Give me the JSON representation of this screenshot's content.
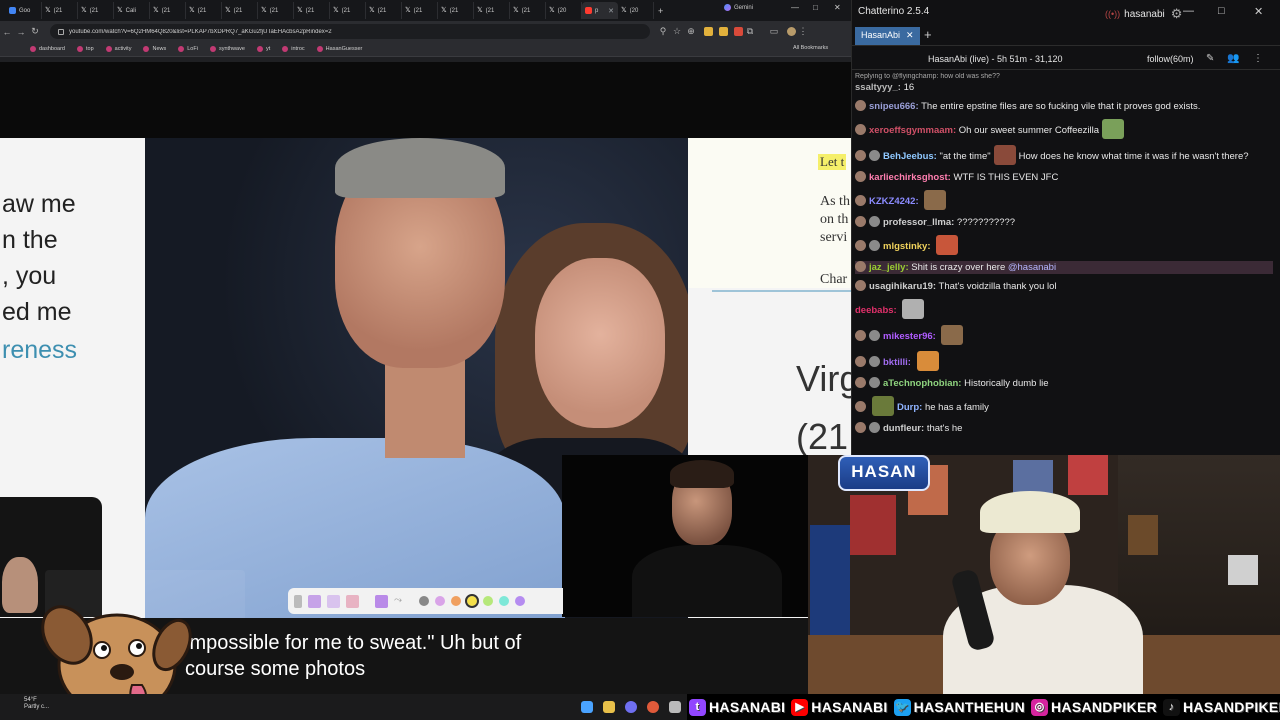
{
  "browser": {
    "tabs": [
      {
        "icon": "google",
        "label": "Goo"
      },
      {
        "icon": "x",
        "label": "(21"
      },
      {
        "icon": "x",
        "label": "(21"
      },
      {
        "icon": "x",
        "label": "Cali"
      },
      {
        "icon": "x",
        "label": "(21"
      },
      {
        "icon": "x",
        "label": "(21"
      },
      {
        "icon": "x",
        "label": "(21"
      },
      {
        "icon": "x",
        "label": "(21"
      },
      {
        "icon": "x",
        "label": "(21"
      },
      {
        "icon": "x",
        "label": "(21"
      },
      {
        "icon": "x",
        "label": "(21"
      },
      {
        "icon": "x",
        "label": "(21"
      },
      {
        "icon": "x",
        "label": "(21"
      },
      {
        "icon": "x",
        "label": "(21"
      },
      {
        "icon": "x",
        "label": "(21"
      },
      {
        "icon": "x",
        "label": "(20"
      },
      {
        "icon": "youtube",
        "label": "p",
        "active": true
      },
      {
        "icon": "x",
        "label": "(20"
      }
    ],
    "gemini_tab": "Gemini",
    "url": "youtube.com/watch?v=6Q2HM64Q820&list=PLKAP7bXDPRQ7_aKGu2fjUTaEHAcbsA2pRindex=2",
    "bookmarks": [
      "dashboard",
      "top",
      "activity",
      "News",
      "LoFi",
      "synthwave",
      "yt",
      "introc",
      "HasanGuesser"
    ],
    "all_bookmarks": "All Bookmarks"
  },
  "page": {
    "left_lines": [
      "aw me",
      "n the",
      ", you",
      "ed me",
      "reness"
    ],
    "right_highlight": "Let t",
    "right_serif_lines": [
      "As th",
      "on th",
      "servi",
      "Char"
    ],
    "right_big_lines": [
      "Virg",
      "(21"
    ]
  },
  "caption": {
    "line1": "impossible for me to sweat.\" Uh but of",
    "line2": "course some photos"
  },
  "taskbar": {
    "weather_temp": "54°F",
    "weather_desc": "Partly c..."
  },
  "chatterino": {
    "app_title": "Chatterino 2.5.4",
    "account": "hasanabi",
    "tab_label": "HasanAbi",
    "channel_info": "HasanAbi (live) - 5h 51m - 31,120",
    "follow_label": "follow(60m)",
    "reply_line": "Replying to @flyingchamp: how old was she??",
    "messages": [
      {
        "user": "ssaltyyy_:",
        "color": "#b9b9b9",
        "text": "16",
        "badges": 0
      },
      {
        "user": "snipeu666:",
        "color": "#9a9fd8",
        "text": "The entire epstine files are so fucking vile that it proves god exists.",
        "badges": 1
      },
      {
        "user": "xeroeffsgymmaam:",
        "color": "#d05067",
        "text": "Oh our sweet summer Coffeezilla",
        "badges": 1,
        "emote_after": true
      },
      {
        "user": "BehJeebus:",
        "color": "#8fc8ff",
        "text": "\"at the time\"",
        "text2": "How does he know what time it was if he wasn't there?",
        "badges": 2,
        "emote_mid": true
      },
      {
        "user": "karliechirksghost:",
        "color": "#ff7fb0",
        "text": "WTF IS THIS EVEN JFC",
        "badges": 1
      },
      {
        "user": "KZKZ4242:",
        "color": "#8b8bff",
        "text": "",
        "badges": 1,
        "emote_after": true
      },
      {
        "user": "professor_llma:",
        "color": "#cfcfcf",
        "text": "???????????",
        "badges": 2
      },
      {
        "user": "mlgstinky:",
        "color": "#f0d25c",
        "text": "",
        "badges": 2,
        "emote_after": true
      },
      {
        "user": "jaz_jelly:",
        "color": "#9acd32",
        "text": "Shit is crazy over here",
        "mention": "@hasanabi",
        "badges": 1,
        "highlight": true
      },
      {
        "user": "usagihikaru19:",
        "color": "#cfcfcf",
        "text": "That's voidzilla thank you lol",
        "badges": 1
      },
      {
        "user": "deebabs:",
        "color": "#e0306a",
        "text": "",
        "badges": 0,
        "emote_after": true
      },
      {
        "user": "mikester96:",
        "color": "#b05cff",
        "text": "",
        "badges": 2,
        "emote_after": true
      },
      {
        "user": "bktilli:",
        "color": "#a06cf0",
        "text": "",
        "badges": 2,
        "emote_after": true
      },
      {
        "user": "aTechnophobian:",
        "color": "#8fd47f",
        "text": "Historically dumb lie",
        "badges": 2
      },
      {
        "user": "Durp:",
        "color": "#8fb3ff",
        "text": "he has a family",
        "badges": 1,
        "emote_before": true
      },
      {
        "user": "dunfleur:",
        "color": "#cfcfcf",
        "text": "that's he",
        "badges": 2
      }
    ]
  },
  "overlay": {
    "hasan_logo": "HASAN",
    "socials": [
      {
        "platform": "twitch",
        "handle": "HASANABI",
        "color": "#9146ff"
      },
      {
        "platform": "youtube",
        "handle": "HASANABI",
        "color": "#ff0000"
      },
      {
        "platform": "twitter",
        "handle": "HASANTHEHUN",
        "color": "#1da1f2"
      },
      {
        "platform": "instagram",
        "handle": "HASANDPIKER",
        "color": "#d6249f"
      },
      {
        "platform": "tiktok",
        "handle": "HASANDPIKER",
        "color": "#111111"
      }
    ]
  },
  "colors": {
    "chatterino_tab": "#3a6aa0",
    "highlight_row": "#3b2a36",
    "caption_bg": "#141414"
  }
}
